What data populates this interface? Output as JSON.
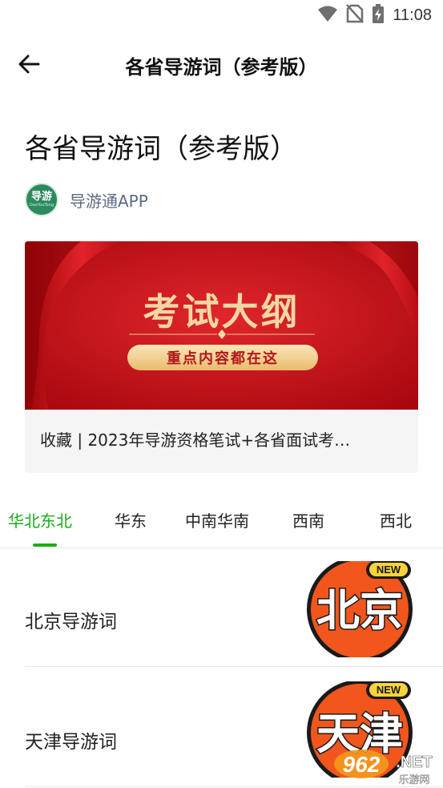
{
  "status_bar": {
    "time": "11:08",
    "icons": [
      "wifi-icon",
      "no-sim-icon",
      "battery-charging-icon"
    ]
  },
  "app_bar": {
    "back_icon": "arrow-left-icon",
    "title": "各省导游词（参考版）"
  },
  "article": {
    "headline": "各省导游词（参考版）",
    "author": {
      "name": "导游通APP",
      "avatar_text": "导游",
      "avatar_subtext": "DaoYouTong"
    },
    "banner": {
      "title": "考试大纲",
      "pill": "重点内容都在这",
      "caption": "收藏 | 2023年导游资格笔试+各省面试考…"
    }
  },
  "tabs": {
    "items": [
      {
        "label": "华北东北",
        "active": true
      },
      {
        "label": "华东",
        "active": false
      },
      {
        "label": "中南华南",
        "active": false
      },
      {
        "label": "西南",
        "active": false
      },
      {
        "label": "西北",
        "active": false
      }
    ]
  },
  "list": {
    "items": [
      {
        "title": "北京导游词",
        "thumb_text": "北京",
        "badge": "NEW"
      },
      {
        "title": "天津导游词",
        "thumb_text": "天津",
        "badge": "NEW"
      }
    ]
  },
  "watermark": {
    "number": "962",
    "suffix": ".NET",
    "site": "乐游网"
  },
  "colors": {
    "accent": "#1aad19",
    "banner_red": "#c8101a",
    "thumb_orange": "#f2561c"
  }
}
